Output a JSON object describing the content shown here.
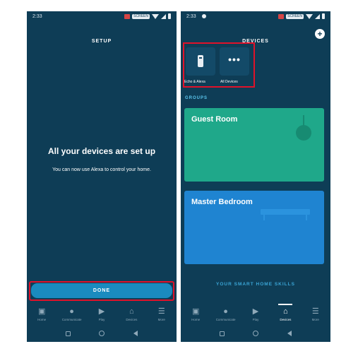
{
  "left_screen": {
    "status": {
      "time": "2:33"
    },
    "header_title": "SETUP",
    "heading": "All your devices are set up",
    "subtext": "You can now use Alexa to control your home.",
    "done_label": "DONE"
  },
  "right_screen": {
    "status": {
      "time": "2:33"
    },
    "header_title": "DEVICES",
    "add_symbol": "+",
    "tiles": [
      {
        "label": "Echo & Alexa",
        "icon": "echo-device-icon"
      },
      {
        "label": "All Devices",
        "glyph": "•••",
        "icon": "more-dots-icon"
      }
    ],
    "groups_label": "GROUPS",
    "groups": [
      {
        "name": "Guest Room",
        "color": "#1fa88a"
      },
      {
        "name": "Master Bedroom",
        "color": "#1f84d1"
      }
    ],
    "skills_label": "YOUR SMART HOME SKILLS"
  },
  "nav": {
    "items": [
      {
        "label": "Home",
        "icon": "home-icon"
      },
      {
        "label": "Communicate",
        "icon": "chat-icon"
      },
      {
        "label": "Play",
        "icon": "play-icon"
      },
      {
        "label": "Devices",
        "icon": "devices-house-icon"
      },
      {
        "label": "More",
        "icon": "menu-icon"
      }
    ],
    "active_on_right": "Devices"
  },
  "status_pill_text": "SCREEN",
  "colors": {
    "background": "#0e3d56",
    "accent": "#1a8bbf",
    "highlight": "#e0122a"
  }
}
